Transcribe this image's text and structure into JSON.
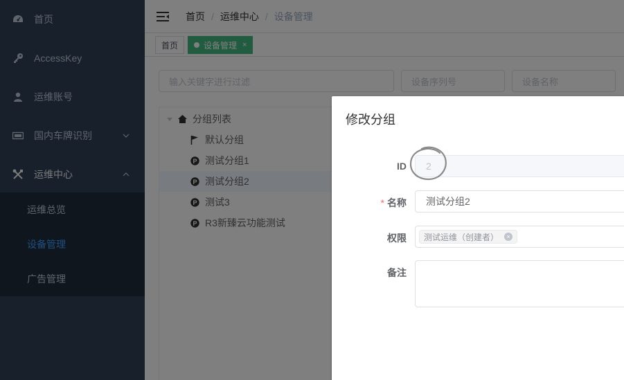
{
  "sidebar": {
    "items": [
      {
        "label": "首页",
        "icon": "dashboard-icon"
      },
      {
        "label": "AccessKey",
        "icon": "key-icon"
      },
      {
        "label": "运维账号",
        "icon": "user-icon"
      },
      {
        "label": "国内车牌识别",
        "icon": "license-plate-icon"
      },
      {
        "label": "运维中心",
        "icon": "tools-icon"
      }
    ],
    "submenu": [
      {
        "label": "运维总览"
      },
      {
        "label": "设备管理"
      },
      {
        "label": "广告管理"
      }
    ]
  },
  "navbar": {
    "breadcrumb": [
      "首页",
      "运维中心",
      "设备管理"
    ],
    "separator": "/"
  },
  "tags": [
    {
      "label": "首页"
    },
    {
      "label": "设备管理",
      "close": "×"
    }
  ],
  "filters": {
    "keyword_placeholder": "输入关键字进行过滤",
    "serial_placeholder": "设备序列号",
    "name_placeholder": "设备名称"
  },
  "tree": {
    "root": "分组列表",
    "children": [
      {
        "label": "默认分组",
        "icon": "flag-icon"
      },
      {
        "label": "测试分组1",
        "icon": "p-badge-icon"
      },
      {
        "label": "测试分组2",
        "icon": "p-badge-icon"
      },
      {
        "label": "测试3",
        "icon": "p-badge-icon"
      },
      {
        "label": "R3新臻云功能测试",
        "icon": "p-badge-icon"
      }
    ]
  },
  "dialog": {
    "title": "修改分组",
    "id_label": "ID",
    "id_value": "2",
    "name_label": "名称",
    "required_mark": "*",
    "name_value": "测试分组2",
    "perm_label": "权限",
    "perm_tag": "测试运维（创建者）",
    "remark_label": "备注"
  },
  "colors": {
    "sidebar_bg": "#304156",
    "submenu_bg": "#1f2d3d",
    "active_text": "#409eff",
    "tag_active": "#42b983",
    "required": "#f56c6c"
  }
}
